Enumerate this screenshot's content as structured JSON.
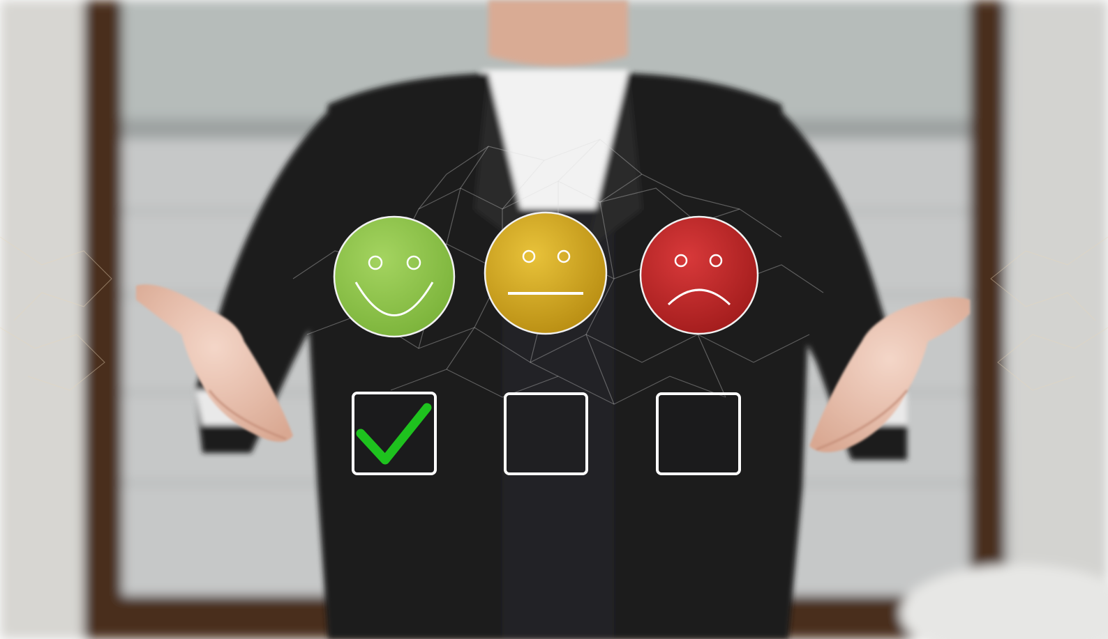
{
  "scene": {
    "subject": "person-in-dark-suit",
    "background": "blurred-office-window"
  },
  "rating": {
    "faces": [
      {
        "mood": "happy",
        "icon": "happy-face-icon",
        "color": "#8cc04b",
        "selected": true
      },
      {
        "mood": "neutral",
        "icon": "neutral-face-icon",
        "color": "#d2a81c",
        "selected": false
      },
      {
        "mood": "sad",
        "icon": "sad-face-icon",
        "color": "#c02a26",
        "selected": false
      }
    ],
    "check_color": "#1ec21e",
    "selected_index": 0
  },
  "colors": {
    "suit": "#1c1c1e",
    "shirt": "#f2f2f2",
    "frame": "#4a2f1e",
    "wall": "#c9cbcc",
    "skin": "#e8c3b2"
  }
}
